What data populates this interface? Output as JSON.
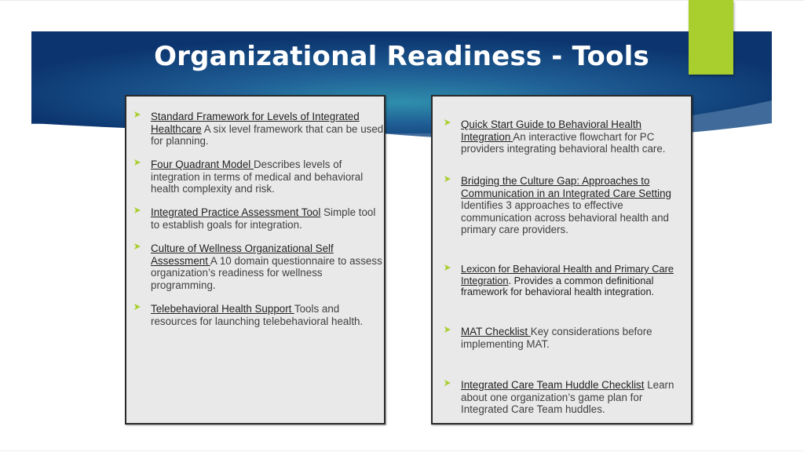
{
  "slide": {
    "title": "Organizational Readiness - Tools",
    "colors": {
      "banner_dark": "#0d3a78",
      "banner_mid": "#2a7fa3",
      "accent_green": "#a8cf2e",
      "panel_bg": "#e9e9e9",
      "bullet": "#a8cf2e"
    }
  },
  "left_panel": {
    "items": [
      {
        "link": "Standard Framework for Levels of Integrated Healthcare",
        "text": " A six level framework that can be used for planning."
      },
      {
        "link": "Four Quadrant Model ",
        "text": "Describes levels of integration in terms of medical and behavioral health complexity and risk."
      },
      {
        "link": "Integrated Practice Assessment Tool",
        "text": " Simple tool to establish goals for integration."
      },
      {
        "link": "Culture of Wellness Organizational Self Assessment ",
        "text": " A 10 domain questionnaire to assess organization’s readiness for wellness programming."
      },
      {
        "link": "Telebehavioral Health Support ",
        "text": "Tools and resources for launching telebehavioral health."
      }
    ]
  },
  "right_panel": {
    "items": [
      {
        "link": "Quick Start Guide to Behavioral Health Integration ",
        "text": "An interactive flowchart for PC providers integrating behavioral health care."
      },
      {
        "link": "Bridging the Culture Gap: Approaches to Communication in an Integrated Care Setting",
        "text": " Identifies 3 approaches to effective communication across behavioral health and primary care providers."
      },
      {
        "link": "Lexicon for Behavioral Health and Primary Care Integration",
        "text": ". Provides a common definitional framework for behavioral health integration."
      },
      {
        "link": "MAT Checklist ",
        "text": "Key considerations before implementing MAT."
      },
      {
        "link": "Integrated Care Team Huddle Checklist",
        "text": " Learn about one organization’s game plan for Integrated Care Team huddles."
      }
    ]
  }
}
